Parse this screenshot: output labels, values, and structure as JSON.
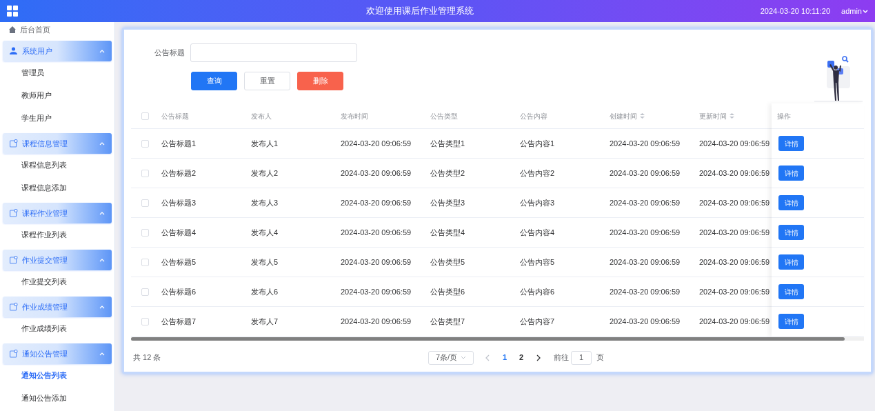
{
  "header": {
    "title": "欢迎使用课后作业管理系统",
    "datetime": "2024-03-20 10:11:20",
    "user": "admin"
  },
  "sidebar": {
    "home": "后台首页",
    "groups": [
      {
        "label": "系统用户",
        "expanded": true,
        "children": [
          {
            "label": "管理员",
            "selected": false
          },
          {
            "label": "教师用户",
            "selected": false
          },
          {
            "label": "学生用户",
            "selected": false
          }
        ]
      },
      {
        "label": "课程信息管理",
        "expanded": true,
        "children": [
          {
            "label": "课程信息列表",
            "selected": false
          },
          {
            "label": "课程信息添加",
            "selected": false
          }
        ]
      },
      {
        "label": "课程作业管理",
        "expanded": true,
        "children": [
          {
            "label": "课程作业列表",
            "selected": false
          }
        ]
      },
      {
        "label": "作业提交管理",
        "expanded": true,
        "children": [
          {
            "label": "作业提交列表",
            "selected": false
          }
        ]
      },
      {
        "label": "作业成绩管理",
        "expanded": true,
        "children": [
          {
            "label": "作业成绩列表",
            "selected": false
          }
        ]
      },
      {
        "label": "通知公告管理",
        "expanded": true,
        "children": [
          {
            "label": "通知公告列表",
            "selected": true
          },
          {
            "label": "通知公告添加",
            "selected": false
          }
        ]
      }
    ]
  },
  "search": {
    "label": "公告标题"
  },
  "buttons": [
    {
      "label": "查询",
      "kind": "primary"
    },
    {
      "label": "重置",
      "kind": "default"
    },
    {
      "label": "删除",
      "kind": "danger"
    }
  ],
  "table": {
    "select_all_checked": false,
    "columns": [
      {
        "label": "公告标题",
        "sortable": false
      },
      {
        "label": "发布人",
        "sortable": false
      },
      {
        "label": "发布时间",
        "sortable": false
      },
      {
        "label": "公告类型",
        "sortable": false
      },
      {
        "label": "公告内容",
        "sortable": false
      },
      {
        "label": "创建时间",
        "sortable": true
      },
      {
        "label": "更新时间",
        "sortable": true
      }
    ],
    "action_column": "操作",
    "rows": [
      {
        "checked": false,
        "cells": [
          "公告标题1",
          "发布人1",
          "2024-03-20 09:06:59",
          "公告类型1",
          "公告内容1",
          "2024-03-20 09:06:59",
          "2024-03-20 09:06:59"
        ],
        "action": "详情"
      },
      {
        "checked": false,
        "cells": [
          "公告标题2",
          "发布人2",
          "2024-03-20 09:06:59",
          "公告类型2",
          "公告内容2",
          "2024-03-20 09:06:59",
          "2024-03-20 09:06:59"
        ],
        "action": "详情"
      },
      {
        "checked": false,
        "cells": [
          "公告标题3",
          "发布人3",
          "2024-03-20 09:06:59",
          "公告类型3",
          "公告内容3",
          "2024-03-20 09:06:59",
          "2024-03-20 09:06:59"
        ],
        "action": "详情"
      },
      {
        "checked": false,
        "cells": [
          "公告标题4",
          "发布人4",
          "2024-03-20 09:06:59",
          "公告类型4",
          "公告内容4",
          "2024-03-20 09:06:59",
          "2024-03-20 09:06:59"
        ],
        "action": "详情"
      },
      {
        "checked": false,
        "cells": [
          "公告标题5",
          "发布人5",
          "2024-03-20 09:06:59",
          "公告类型5",
          "公告内容5",
          "2024-03-20 09:06:59",
          "2024-03-20 09:06:59"
        ],
        "action": "详情"
      },
      {
        "checked": false,
        "cells": [
          "公告标题6",
          "发布人6",
          "2024-03-20 09:06:59",
          "公告类型6",
          "公告内容6",
          "2024-03-20 09:06:59",
          "2024-03-20 09:06:59"
        ],
        "action": "详情"
      },
      {
        "checked": false,
        "cells": [
          "公告标题7",
          "发布人7",
          "2024-03-20 09:06:59",
          "公告类型7",
          "公告内容7",
          "2024-03-20 09:06:59",
          "2024-03-20 09:06:59"
        ],
        "action": "详情"
      }
    ]
  },
  "pagination": {
    "total": "共 12 条",
    "page_size": "7条/页",
    "pages": [
      {
        "label": "1",
        "selected": true
      },
      {
        "label": "2",
        "selected": false
      }
    ],
    "goto_label": "前往",
    "goto_value": "1",
    "goto_suffix": "页"
  }
}
